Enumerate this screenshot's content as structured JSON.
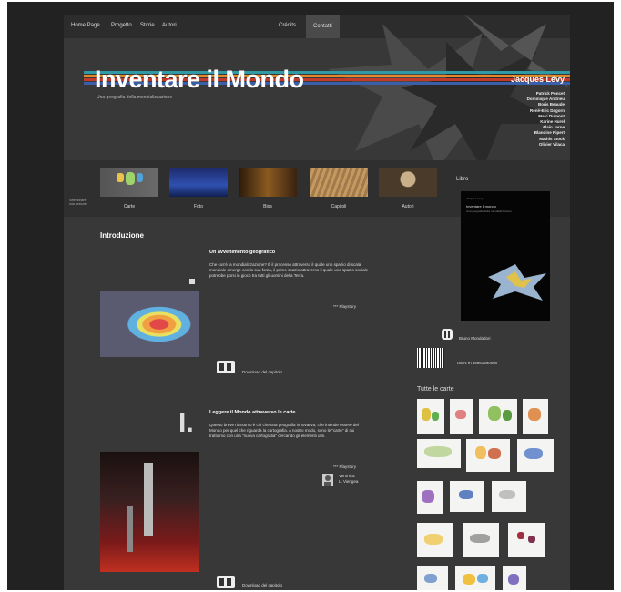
{
  "nav": {
    "left": [
      "Home Page",
      "Progetto",
      "Storie",
      "Autori"
    ],
    "right": [
      "Crédits",
      "Contatti"
    ]
  },
  "header": {
    "title": "Inventare il Mondo",
    "subtitle": "Una geografia della mondializzazione",
    "author_main": "Jacques Lévy",
    "authors": [
      "Patrick Poncet",
      "Dominique Andrieu",
      "Boris Beaude",
      "René-Eric Dagorn",
      "Marc Dumont",
      "Karine Hurel",
      "Alain Jarne",
      "Blandine Ripert",
      "Mathis Stock",
      "Olivier Vilaca"
    ]
  },
  "gallery": {
    "items": [
      "Carte",
      "Foto",
      "Bios",
      "Capitoli",
      "Autori"
    ],
    "side_note": [
      "Selezionare",
      "una sezione"
    ]
  },
  "libro": {
    "label": "Libro",
    "book_small": "Jacques Lévy",
    "book_title": "Inventare il mondo",
    "book_subtitle": "Una geografia della mondializzazione",
    "publisher": "Bruno Mondadori",
    "isbn": "ISBN 9788861590000"
  },
  "intro": {
    "heading": "Introduzione"
  },
  "articles": [
    {
      "number": "",
      "title": "Un avvenimento geografico",
      "body": "Che cos'è la mondializzazione? È il processo attraverso il quale uno spazio di scala mondiale emerge con la sua forza, il primo spazio attraverso il quale uno spazio sociale potrebbe porsi in gioco tra tutti gli uomini della Terra.",
      "more": "Playstory",
      "download": "Download del capitolo"
    },
    {
      "number": "I.",
      "title": "Leggere il Mondo attraverso le carte",
      "body": "Questo breve riassunto è ciò che una geografia innovativa, che intende essere del Mondo per quel che riguarda la cartografia. A nostro modo, sono le \"carte\" di cui trattiamo con una \"nuova cartografia\" cercando gli elementi utili.",
      "more": "Playstory",
      "author_tag": [
        "Veronica",
        "L. Viengea"
      ],
      "download": "Download del capitolo"
    }
  ],
  "sidebar": {
    "tutte_label": "Tutte le carte"
  },
  "colors": {
    "page_bg": "#383838",
    "frame_bg": "#222222",
    "stripe_red": "#c0392b",
    "stripe_orange": "#e08a2c",
    "stripe_teal": "#2f9aa6",
    "stripe_blue": "#3a5fa8"
  }
}
